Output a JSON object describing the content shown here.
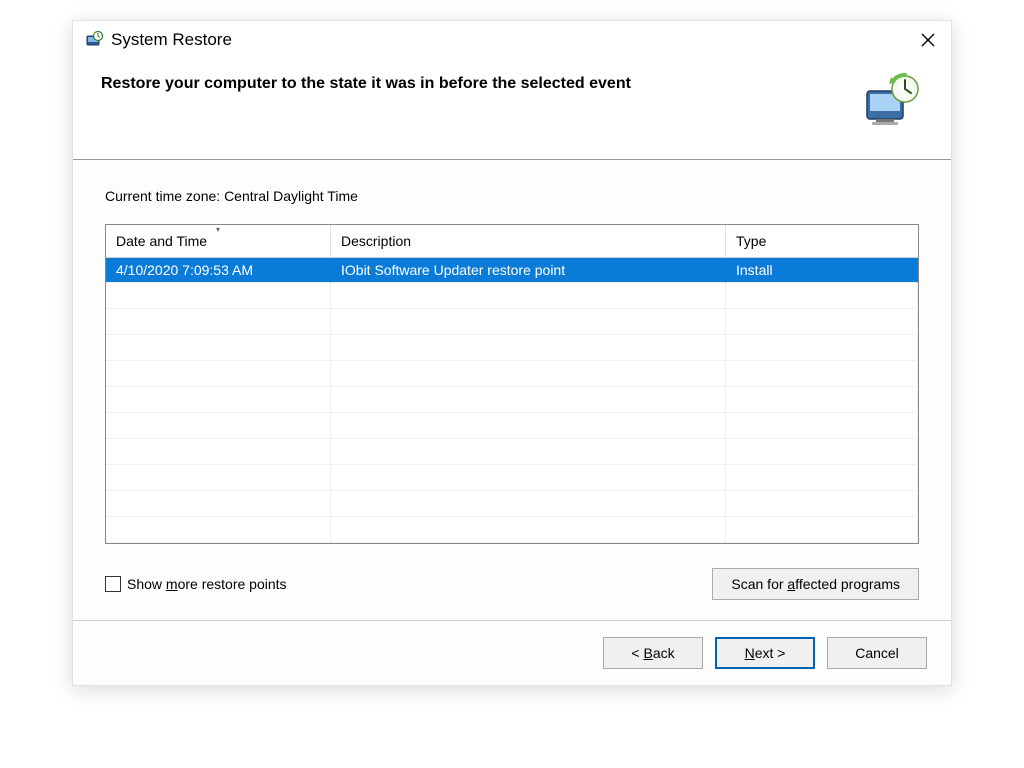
{
  "window": {
    "title": "System Restore"
  },
  "header": {
    "heading": "Restore your computer to the state it was in before the selected event"
  },
  "content": {
    "timezone_prefix": "Current time zone:",
    "timezone_value": "Central Daylight Time",
    "columns": {
      "datetime": "Date and Time",
      "description": "Description",
      "type": "Type"
    },
    "rows": [
      {
        "datetime": "4/10/2020 7:09:53 AM",
        "description": "IObit Software Updater restore point",
        "type": "Install",
        "selected": true
      }
    ],
    "show_more_pre": "Show ",
    "show_more_ak": "m",
    "show_more_post": "ore restore points",
    "scan_pre": "Scan for ",
    "scan_ak": "a",
    "scan_post": "ffected programs"
  },
  "footer": {
    "back_pre": "< ",
    "back_ak": "B",
    "back_post": "ack",
    "next_ak": "N",
    "next_post": "ext >",
    "cancel": "Cancel"
  }
}
